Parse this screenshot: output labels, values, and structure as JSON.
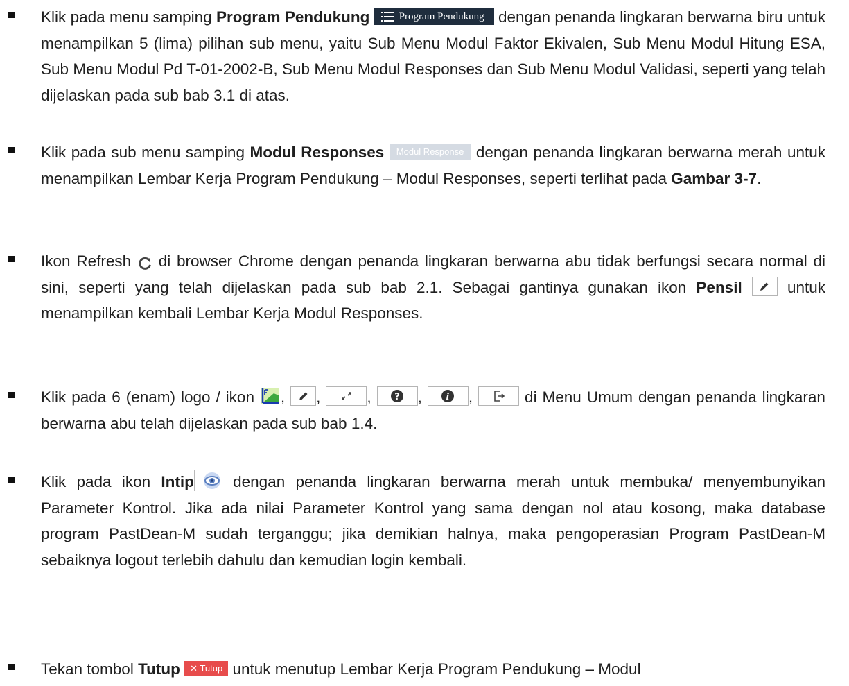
{
  "items": [
    {
      "pre": "Klik pada menu samping ",
      "bold": "Program Pendukung",
      "chip": "Program Pendukung",
      "post": " dengan penanda lingkaran berwarna biru untuk menampilkan 5 (lima) pilihan sub menu, yaitu Sub Menu Modul Faktor Ekivalen, Sub Menu Modul Hitung ESA, Sub Menu Modul Pd T-01-2002-B, Sub Menu Modul Responses dan Sub Menu Modul Validasi, seperti yang telah dijelaskan pada sub bab 3.1 di atas."
    },
    {
      "pre": "Klik pada sub menu samping ",
      "bold": "Modul Responses",
      "chip": "Modul Response",
      "mid": " dengan penanda lingkaran berwarna merah untuk menampilkan Lembar Kerja Program Pendukung – Modul Responses, seperti terlihat pada ",
      "bold2": "Gambar 3-7",
      "post": "."
    },
    {
      "pre": "Ikon Refresh ",
      "mid": " di browser Chrome dengan penanda lingkaran berwarna abu tidak berfungsi secara normal di sini, seperti yang telah dijelaskan pada sub bab 2.1.  Sebagai gantinya gunakan ikon ",
      "bold": "Pensil",
      "post": " untuk menampilkan kembali Lembar Kerja Modul Responses."
    },
    {
      "pre": "Klik pada 6 (enam) logo / ikon ",
      "sep": ",",
      "post": " di Menu Umum  dengan penanda lingkaran berwarna abu telah dijelaskan pada sub bab 1.4."
    },
    {
      "pre": "Klik pada ikon ",
      "bold": "Intip",
      "post": " dengan penanda lingkaran berwarna merah untuk membuka/ menyembunyikan Parameter Kontrol.  Jika ada nilai Parameter Kontrol yang sama dengan nol atau kosong, maka database program PastDean-M sudah terganggu;  jika demikian halnya, maka pengoperasian Program PastDean-M sebaiknya logout terlebih dahulu dan kemudian login kembali."
    },
    {
      "pre": "Tekan tombol ",
      "bold": "Tutup",
      "chip": "Tutup",
      "post": " untuk menutup Lembar Kerja Program Pendukung – Modul"
    }
  ],
  "colors": {
    "menu_chip_bg": "#1f2d3d",
    "submenu_chip_bg": "#d5dbe3",
    "refresh_icon": "#444444",
    "eye_icon": "#5a7fc0",
    "close_button_bg": "#e74c4c"
  }
}
